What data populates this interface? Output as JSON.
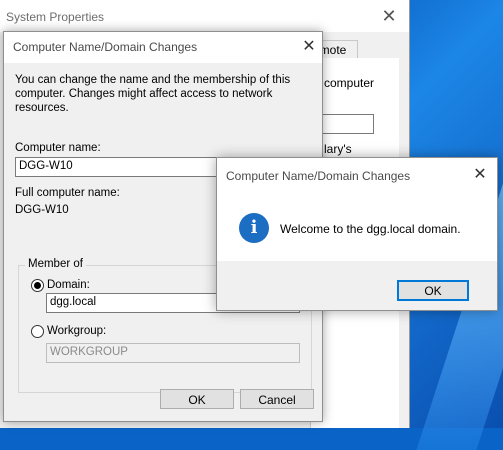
{
  "system_properties": {
    "title": "System Properties",
    "close_glyph": "✕",
    "tab_label": "emote",
    "side_text_1": "computer",
    "side_text_2": "lary's"
  },
  "dialog": {
    "title": "Computer Name/Domain Changes",
    "close_glyph": "✕",
    "intro": "You can change the name and the membership of this computer. Changes might affect access to network resources.",
    "computer_name_label": "Computer name:",
    "computer_name_value": "DGG-W10",
    "full_name_label": "Full computer name:",
    "full_name_value": "DGG-W10",
    "member_of_label": "Member of",
    "domain_label": "Domain:",
    "domain_value": "dgg.local",
    "domain_selected": true,
    "workgroup_label": "Workgroup:",
    "workgroup_value": "WORKGROUP",
    "ok_label": "OK",
    "cancel_label": "Cancel"
  },
  "message_box": {
    "title": "Computer Name/Domain Changes",
    "close_glyph": "✕",
    "icon": "information-icon",
    "icon_glyph": "i",
    "message": "Welcome to the dgg.local domain.",
    "ok_label": "OK"
  },
  "colors": {
    "accent": "#0078d7",
    "info_icon": "#1b6ec2",
    "desktop": "#0a64c8"
  }
}
